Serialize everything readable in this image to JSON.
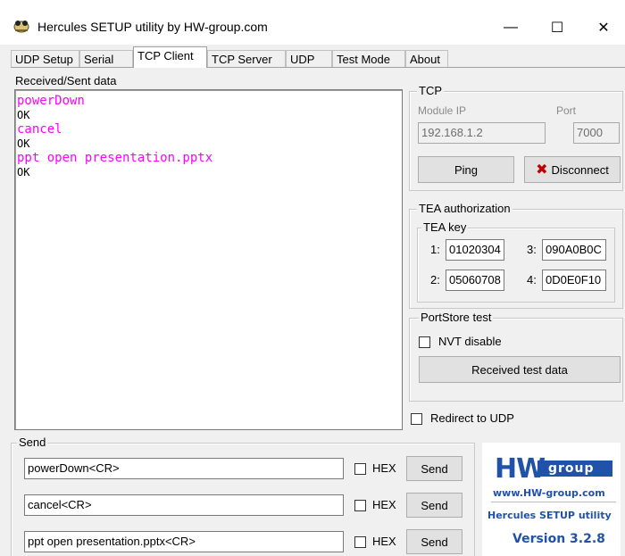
{
  "window": {
    "title": "Hercules SETUP utility by HW-group.com",
    "minimize_symbol": "—",
    "maximize_symbol": "☐",
    "close_symbol": "✕"
  },
  "tabs": [
    {
      "label": "UDP Setup",
      "active": false
    },
    {
      "label": "Serial",
      "active": false
    },
    {
      "label": "TCP Client",
      "active": true
    },
    {
      "label": "TCP Server",
      "active": false
    },
    {
      "label": "UDP",
      "active": false
    },
    {
      "label": "Test Mode",
      "active": false
    },
    {
      "label": "About",
      "active": false
    }
  ],
  "received": {
    "label": "Received/Sent data",
    "lines": [
      {
        "text": "powerDown",
        "kind": "sent"
      },
      {
        "text": "OK",
        "kind": "recv"
      },
      {
        "text": "cancel",
        "kind": "sent"
      },
      {
        "text": "OK",
        "kind": "recv"
      },
      {
        "text": "ppt open presentation.pptx",
        "kind": "sent"
      },
      {
        "text": "OK",
        "kind": "recv"
      }
    ],
    "sent_color": "#ff00ff"
  },
  "tcp": {
    "title": "TCP",
    "module_ip_label": "Module IP",
    "port_label": "Port",
    "module_ip": "192.168.1.2",
    "port": "7000",
    "ping_label": "Ping",
    "disconnect_label": "Disconnect"
  },
  "tea": {
    "title": "TEA authorization",
    "key_title": "TEA key",
    "keys": [
      {
        "index": "1:",
        "value": "01020304"
      },
      {
        "index": "3:",
        "value": "090A0B0C"
      },
      {
        "index": "2:",
        "value": "05060708"
      },
      {
        "index": "4:",
        "value": "0D0E0F10"
      }
    ]
  },
  "portstore": {
    "title": "PortStore test",
    "nvt_label": "NVT disable",
    "received_test_label": "Received test data"
  },
  "redirect_label": "Redirect to UDP",
  "send": {
    "title": "Send",
    "hex_label": "HEX",
    "send_label": "Send",
    "rows": [
      {
        "value": "powerDown<CR>"
      },
      {
        "value": "cancel<CR>"
      },
      {
        "value": "ppt open presentation.pptx<CR>"
      }
    ]
  },
  "logo": {
    "hw": "HW",
    "group": "group",
    "url": "www.HW-group.com",
    "tagline": "Hercules SETUP utility",
    "version": "Version  3.2.8",
    "brand_color": "#1f52a8"
  }
}
